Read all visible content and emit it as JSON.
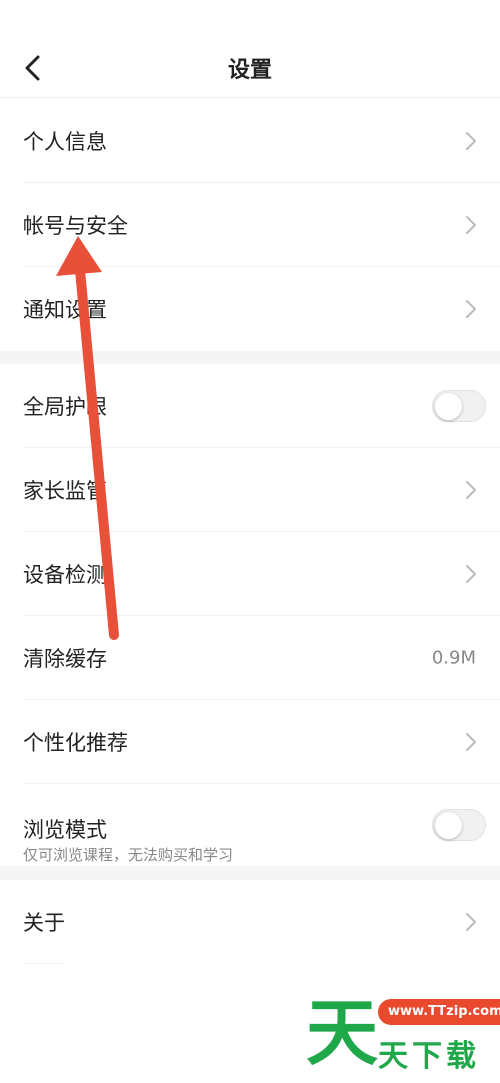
{
  "header": {
    "title": "设置",
    "back_icon": "chevron-left-icon"
  },
  "section1": [
    {
      "label": "个人信息"
    },
    {
      "label": "帐号与安全"
    },
    {
      "label": "通知设置"
    }
  ],
  "section2": [
    {
      "label": "全局护眼",
      "toggle": false
    },
    {
      "label": "家长监管"
    },
    {
      "label": "设备检测"
    },
    {
      "label": "清除缓存",
      "value": "0.9M"
    },
    {
      "label": "个性化推荐"
    },
    {
      "label": "浏览模式",
      "sublabel": "仅可浏览课程，无法购买和学习",
      "toggle": false
    }
  ],
  "section3": [
    {
      "label": "关于"
    }
  ],
  "watermark": {
    "big": "天",
    "url": "www.TTzip.com",
    "small": "天下载"
  },
  "colors": {
    "arrow": "#e8503a",
    "watermark_green": "#1fa84a",
    "watermark_red": "#e94a2e"
  }
}
